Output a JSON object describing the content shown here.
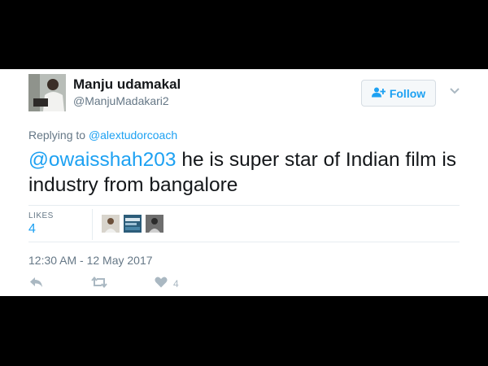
{
  "user": {
    "display_name": "Manju udamakal",
    "handle": "@ManjuMadakari2"
  },
  "follow_button": {
    "label": "Follow",
    "icon": "follow-user-icon"
  },
  "reply_context": {
    "prefix": "Replying to",
    "mention": "@alextudorcoach"
  },
  "tweet": {
    "mention": "@owaisshah203",
    "text": " he is super star of Indian film is industry from bangalore"
  },
  "stats": {
    "likes_label": "LIKES",
    "likes_count": "4"
  },
  "timestamp": "12:30 AM - 12 May 2017",
  "actions": {
    "reply_icon": "reply-icon",
    "retweet_icon": "retweet-icon",
    "like_icon": "heart-icon",
    "like_count": "4"
  },
  "colors": {
    "accent": "#1da1f2",
    "muted": "#657786",
    "icon": "#aab8c2",
    "text": "#14171a"
  }
}
